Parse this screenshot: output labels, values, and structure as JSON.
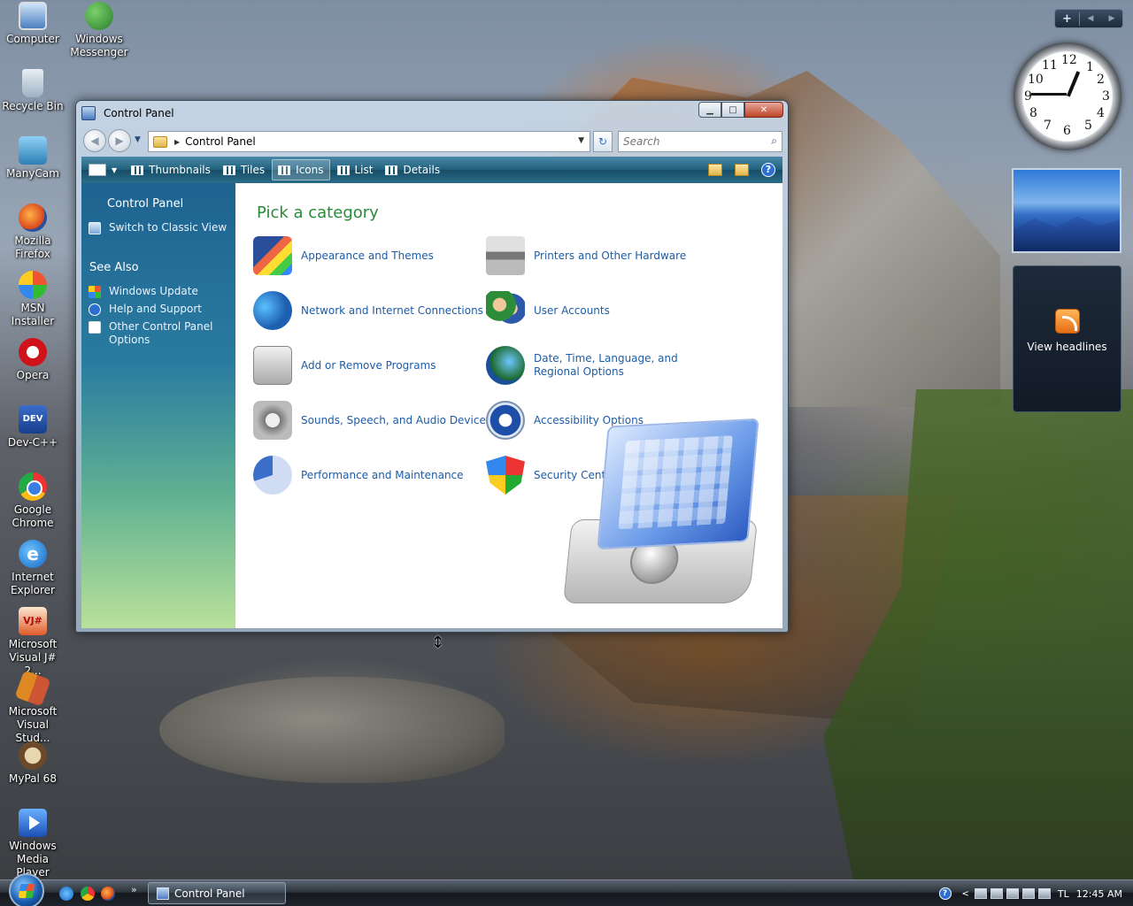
{
  "desktop": {
    "icons": [
      {
        "label": "Computer",
        "icon": "computer-icon"
      },
      {
        "label": "Windows Messenger",
        "icon": "messenger-icon"
      },
      {
        "label": "Recycle Bin",
        "icon": "recycle-bin-icon"
      },
      {
        "label": "ManyCam",
        "icon": "manycam-icon"
      },
      {
        "label": "Mozilla Firefox",
        "icon": "firefox-icon"
      },
      {
        "label": "MSN Installer",
        "icon": "msn-icon"
      },
      {
        "label": "Opera",
        "icon": "opera-icon"
      },
      {
        "label": "Dev-C++",
        "icon": "devcpp-icon"
      },
      {
        "label": "Google Chrome",
        "icon": "chrome-icon"
      },
      {
        "label": "Internet Explorer",
        "icon": "ie-icon"
      },
      {
        "label": "Microsoft Visual J# 2...",
        "icon": "visual-j-icon"
      },
      {
        "label": "Microsoft Visual Stud...",
        "icon": "visual-studio-icon"
      },
      {
        "label": "MyPal 68",
        "icon": "mypal-icon"
      },
      {
        "label": "Windows Media Player",
        "icon": "wmp-icon"
      }
    ],
    "devcpp_glyph": "DEV",
    "ie_glyph": "e",
    "vjs_glyph": "VJ#"
  },
  "window": {
    "title": "Control Panel",
    "controls": {
      "minimize": "▁",
      "maximize": "□",
      "close": "✕"
    },
    "address": {
      "path": "Control Panel",
      "back_glyph": "◀",
      "forward_glyph": "▶",
      "dropdown_glyph": "▼",
      "crumb_glyph": "▶",
      "refresh_glyph": "↻"
    },
    "search": {
      "placeholder": "Search",
      "icon_glyph": "⌕"
    },
    "toolbar": {
      "items": [
        {
          "label": "Thumbnails",
          "selected": false
        },
        {
          "label": "Tiles",
          "selected": false
        },
        {
          "label": "Icons",
          "selected": true
        },
        {
          "label": "List",
          "selected": false
        },
        {
          "label": "Details",
          "selected": false
        }
      ],
      "arrow_glyph": "▼",
      "help_glyph": "?"
    },
    "sidebar": {
      "title": "Control Panel",
      "switch_link": "Switch to Classic View",
      "see_also_title": "See Also",
      "see_also": [
        {
          "label": "Windows Update",
          "icon": "windows-update-icon"
        },
        {
          "label": "Help and Support",
          "icon": "help-icon"
        },
        {
          "label": "Other Control Panel Options",
          "icon": "other-options-icon"
        }
      ]
    },
    "content": {
      "heading": "Pick a category",
      "categories_left": [
        {
          "label": "Appearance and Themes",
          "icon": "appearance-icon"
        },
        {
          "label": "Network and Internet Connections",
          "icon": "network-icon"
        },
        {
          "label": "Add or Remove Programs",
          "icon": "add-remove-icon"
        },
        {
          "label": "Sounds, Speech, and Audio Devices",
          "icon": "sounds-icon"
        },
        {
          "label": "Performance and Maintenance",
          "icon": "performance-icon"
        }
      ],
      "categories_right": [
        {
          "label": "Printers and Other Hardware",
          "icon": "printers-icon"
        },
        {
          "label": "User Accounts",
          "icon": "user-accounts-icon"
        },
        {
          "label": "Date, Time, Language, and Regional Options",
          "icon": "date-time-icon"
        },
        {
          "label": "Accessibility Options",
          "icon": "accessibility-icon"
        },
        {
          "label": "Security Center",
          "icon": "security-icon"
        }
      ]
    }
  },
  "gadgets": {
    "controls": {
      "add": "+",
      "prev": "◀",
      "next": "▶"
    },
    "clock": {
      "time": "12:45",
      "numbers": [
        "12",
        "1",
        "2",
        "3",
        "4",
        "5",
        "6",
        "7",
        "8",
        "9",
        "10",
        "11"
      ]
    },
    "feed": {
      "label": "View headlines"
    }
  },
  "cursor_glyph": "↕",
  "taskbar": {
    "ql_more": "»",
    "task_label": "Control Panel",
    "tray": {
      "help": "?",
      "chevron": "<",
      "lang": "TL",
      "time": "12:45 AM"
    }
  },
  "colors": {
    "heading": "#2a8a3a",
    "link": "#1c5ca8",
    "toolbar": "#1f5f7c"
  }
}
